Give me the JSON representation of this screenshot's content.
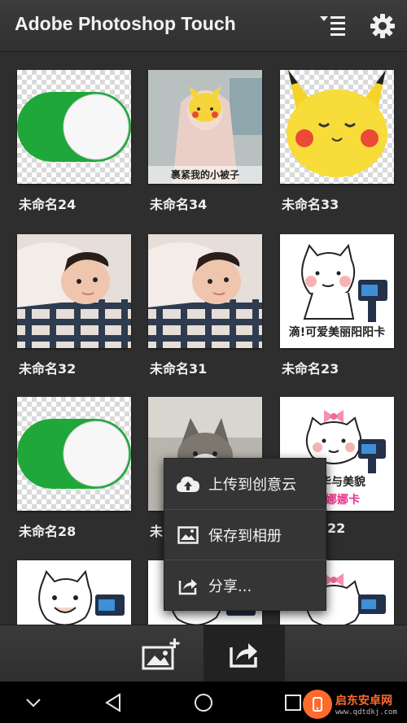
{
  "app": {
    "title": "Adobe Photoshop Touch"
  },
  "colors": {
    "appbar": "#333333",
    "toggle_green": "#1fa839",
    "menu_bg": "#353535",
    "watermark": "#ff6b2c"
  },
  "grid": {
    "items": [
      {
        "label": "未命名24",
        "thumb": "green-toggle"
      },
      {
        "label": "未命名34",
        "thumb": "baby-blanket-photo",
        "caption": "裹紧我的小被子"
      },
      {
        "label": "未命名33",
        "thumb": "pikachu-face"
      },
      {
        "label": "未命名32",
        "thumb": "baby-photo"
      },
      {
        "label": "未命名31",
        "thumb": "baby-photo"
      },
      {
        "label": "未命名23",
        "thumb": "cat-meme",
        "caption": "滴!可爱美丽阳阳卡"
      },
      {
        "label": "未命名28",
        "thumb": "green-toggle"
      },
      {
        "label": "未",
        "thumb": "cat-photo"
      },
      {
        "label": "22",
        "thumb": "bow-cat-meme",
        "caption": "才华与美貌",
        "caption2": "之娜娜卡"
      },
      {
        "label": "",
        "thumb": "cat-meme"
      },
      {
        "label": "",
        "thumb": "cat-meme"
      },
      {
        "label": "",
        "thumb": "bow-cat-meme"
      }
    ]
  },
  "context_menu": {
    "items": [
      {
        "label": "上传到创意云",
        "icon": "cloud-upload-icon"
      },
      {
        "label": "保存到相册",
        "icon": "image-icon"
      },
      {
        "label": "分享...",
        "icon": "share-icon"
      }
    ]
  },
  "toolbar": {
    "add_icon": "add-image-icon",
    "share_icon": "share-icon"
  },
  "watermark": {
    "title": "启东安卓网",
    "url": "www.qdtdkj.com"
  }
}
